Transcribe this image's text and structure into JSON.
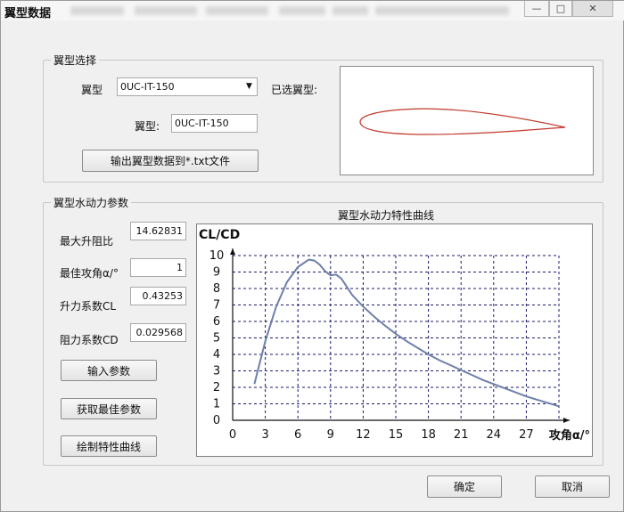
{
  "window": {
    "title": "翼型数据",
    "controls": {
      "minimize": "—",
      "maximize": "□",
      "close": "✕"
    }
  },
  "selection_group": {
    "title": "翼型选择",
    "airfoil_label": "翼型",
    "airfoil_combo_value": "0UC-IT-150",
    "selected_label": "已选翼型:",
    "name_label": "翼型:",
    "name_value": "0UC-IT-150",
    "export_button": "输出翼型数据到*.txt文件"
  },
  "hydro_group": {
    "title": "翼型水动力参数",
    "max_lift_drag_label": "最大升阻比",
    "max_lift_drag_value": "14.62831",
    "best_aoa_label": "最佳攻角α/°",
    "best_aoa_value": "1",
    "cl_label": "升力系数CL",
    "cl_value": "0.43253",
    "cd_label": "阻力系数CD",
    "cd_value": "0.029568",
    "input_button": "输入参数",
    "get_best_button": "获取最佳参数",
    "plot_button": "绘制特性曲线"
  },
  "footer": {
    "ok_button": "确定",
    "cancel_button": "取消"
  },
  "colors": {
    "curve": "#6e7fa8",
    "airfoil": "#c0392b",
    "grid": "#1a1a6e"
  },
  "chart_data": {
    "type": "line",
    "title": "翼型水动力特性曲线",
    "ylabel": "CL/CD",
    "xlabel": "攻角α/°",
    "x_ticks": [
      "0",
      "3",
      "6",
      "9",
      "12",
      "15",
      "18",
      "21",
      "24",
      "27"
    ],
    "y_ticks": [
      "0",
      "1",
      "2",
      "3",
      "4",
      "5",
      "6",
      "7",
      "8",
      "9",
      "10"
    ],
    "xlim": [
      0,
      30
    ],
    "ylim": [
      0,
      10
    ],
    "grid": true,
    "series": [
      {
        "x": [
          2,
          3,
          4,
          5,
          6,
          7,
          7.5,
          8,
          8.5,
          9,
          9.5,
          10,
          11,
          12,
          13,
          14,
          15,
          16,
          17,
          18,
          19,
          20,
          21,
          22,
          23,
          24,
          25,
          26,
          27,
          28,
          29,
          30
        ],
        "y": [
          2.2,
          4.8,
          6.9,
          8.4,
          9.3,
          9.75,
          9.7,
          9.45,
          9.05,
          8.8,
          8.85,
          8.6,
          7.6,
          6.9,
          6.3,
          5.75,
          5.25,
          4.8,
          4.4,
          4.0,
          3.65,
          3.35,
          3.05,
          2.75,
          2.45,
          2.2,
          1.95,
          1.7,
          1.45,
          1.25,
          1.05,
          0.85
        ]
      }
    ]
  }
}
